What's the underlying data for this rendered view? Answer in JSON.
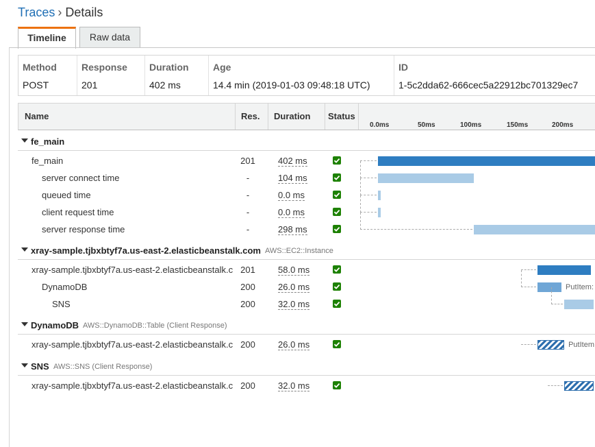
{
  "breadcrumb": {
    "parent": "Traces",
    "separator": "›",
    "current": "Details"
  },
  "tabs": [
    {
      "label": "Timeline",
      "active": true
    },
    {
      "label": "Raw data",
      "active": false
    }
  ],
  "summary": {
    "method": {
      "header": "Method",
      "value": "POST"
    },
    "response": {
      "header": "Response",
      "value": "201"
    },
    "duration": {
      "header": "Duration",
      "value": "402 ms"
    },
    "age": {
      "header": "Age",
      "value": "14.4 min (2019-01-03 09:48:18 UTC)"
    },
    "id": {
      "header": "ID",
      "value": "1-5c2dda62-666cec5a22912bc701329ec7"
    }
  },
  "columns": {
    "name": "Name",
    "res": "Res.",
    "duration": "Duration",
    "status": "Status"
  },
  "ticks": [
    "0.0ms",
    "50ms",
    "100ms",
    "150ms",
    "200ms"
  ],
  "groups": [
    {
      "name": "fe_main",
      "type": "",
      "rows": [
        {
          "name": "fe_main",
          "res": "201",
          "duration": "402 ms",
          "bar": "dark",
          "start": 0,
          "end": 402
        },
        {
          "name": "server connect time",
          "res": "-",
          "duration": "104 ms",
          "bar": "light",
          "start": 0,
          "end": 104
        },
        {
          "name": "queued time",
          "res": "-",
          "duration": "0.0 ms",
          "bar": "light",
          "start": 0,
          "end": 0
        },
        {
          "name": "client request time",
          "res": "-",
          "duration": "0.0 ms",
          "bar": "light",
          "start": 0,
          "end": 0
        },
        {
          "name": "server response time",
          "res": "-",
          "duration": "298 ms",
          "bar": "light",
          "start": 104,
          "end": 402
        }
      ]
    },
    {
      "name": "xray-sample.tjbxbtyf7a.us-east-2.elasticbeanstalk.com",
      "type": "AWS::EC2::Instance",
      "rows": [
        {
          "name": "xray-sample.tjbxbtyf7a.us-east-2.elasticbeanstalk.c",
          "res": "201",
          "duration": "58.0 ms",
          "bar": "dark",
          "start": 173,
          "end": 231
        },
        {
          "name": "DynamoDB",
          "res": "200",
          "duration": "26.0 ms",
          "bar": "mid",
          "start": 173,
          "end": 199,
          "label": "PutItem:"
        },
        {
          "name": "SNS",
          "res": "200",
          "duration": "32.0 ms",
          "bar": "light",
          "start": 202,
          "end": 234
        }
      ]
    },
    {
      "name": "DynamoDB",
      "type": "AWS::DynamoDB::Table (Client Response)",
      "rows": [
        {
          "name": "xray-sample.tjbxbtyf7a.us-east-2.elasticbeanstalk.c",
          "res": "200",
          "duration": "26.0 ms",
          "bar": "hatch",
          "start": 173,
          "end": 202,
          "label": "PutItem:"
        }
      ]
    },
    {
      "name": "SNS",
      "type": "AWS::SNS (Client Response)",
      "rows": [
        {
          "name": "xray-sample.tjbxbtyf7a.us-east-2.elasticbeanstalk.c",
          "res": "200",
          "duration": "32.0 ms",
          "bar": "hatch",
          "start": 202,
          "end": 234
        }
      ]
    }
  ]
}
